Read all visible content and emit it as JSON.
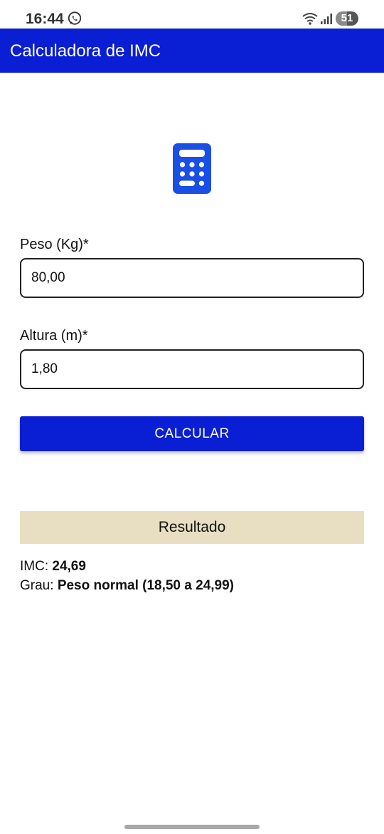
{
  "status_bar": {
    "time": "16:44",
    "battery_level": "51",
    "icons": [
      "whatsapp-icon",
      "wifi-icon",
      "signal-icon",
      "battery-icon"
    ]
  },
  "app_bar": {
    "title": "Calculadora de IMC"
  },
  "header_icon": "calculator-icon",
  "form": {
    "weight_label": "Peso (Kg)*",
    "weight_value": "80,00",
    "height_label": "Altura (m)*",
    "height_value": "1,80",
    "calculate_label": "CALCULAR"
  },
  "result": {
    "header": "Resultado",
    "imc_label": "IMC: ",
    "imc_value": "24,69",
    "grade_label": "Grau: ",
    "grade_value": "Peso normal (18,50 a 24,99)"
  },
  "colors": {
    "primary": "#0a1ed4",
    "icon_blue": "#1a4fe6",
    "result_header_bg": "#e8dec2"
  }
}
